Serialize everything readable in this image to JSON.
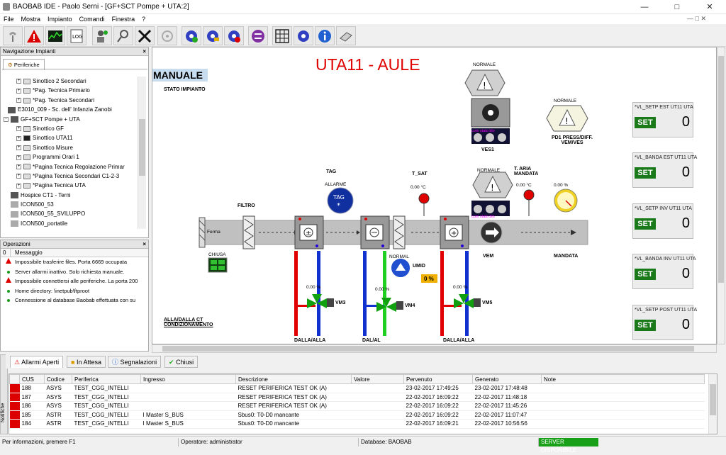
{
  "window": {
    "title": "BAOBAB IDE - Paolo Serni - [GF+SCT Pompe + UTA:2]"
  },
  "menu": [
    "File",
    "Mostra",
    "Impianto",
    "Comandi",
    "Finestra",
    "?"
  ],
  "nav": {
    "title": "Navigazione Impianti",
    "tab": "Periferiche",
    "items": [
      "Sinottico 2 Secondari",
      "*Pag. Tecnica Primario",
      "*Pag. Tecnica Secondari",
      "E3010_009 - Sc. dell' Infanzia Zanobi",
      "GF+SCT Pompe + UTA",
      "Sinottico GF",
      "Sinottico UTA11",
      "Sinottico Misure",
      "Programmi Orari 1",
      "*Pagina Tecnica Regolazione Primar",
      "*Pagina Tecnica Secondari C1-2-3",
      "*Pagina Tecnica UTA",
      "Hospice CT1 - Terni",
      "ICON500_53",
      "ICON500_55_SVILUPPO",
      "ICON500_portatile"
    ]
  },
  "ops": {
    "title": "Operazioni",
    "col_num": "0",
    "col_msg": "Messaggio",
    "rows": [
      {
        "type": "err",
        "text": "Impossibile trasferire files. Porta 6669 occupata"
      },
      {
        "type": "ok",
        "text": "Server allarmi inattivo. Solo richiesta manuale."
      },
      {
        "type": "err",
        "text": "Impossibile connettersi alle periferiche. La porta 200"
      },
      {
        "type": "ok",
        "text": "Home directory: \\inetpub\\ftproot"
      },
      {
        "type": "ok",
        "text": "Connessione al database Baobab effettuata con su"
      }
    ]
  },
  "synoptic": {
    "title": "UTA11 - AULE",
    "mode": "MANUALE",
    "stato": "STATO IMPIANTO",
    "filtro": "FILTRO",
    "ferma": "Ferma",
    "chiusa": "CHIUSA",
    "tag": "TAG",
    "allarme": "ALLARME",
    "tsat": "T_SAT",
    "tsat_val": "0.00 °C",
    "taria": "T. ARIA MANDATA",
    "taria_val": "0.00 °C",
    "press_val": "0.00 %",
    "umid": "UMID",
    "umid_normal": "NORMAL",
    "umid_val": "0 %",
    "ves_normale": "NORMALE",
    "ves": "VES1",
    "pd1_normale": "NORMALE",
    "pd1": "PD1 PRESS/DIFF. VEM/VES",
    "vem_normale": "NORMALE",
    "vem": "VEM",
    "mandata": "MANDATA",
    "com_stato": "com  stato  blo",
    "vm3": "VM3",
    "vm3_val": "0.00 %",
    "vm4": "VM4",
    "vm4_val": "0.00 %",
    "vm5": "VM5",
    "vm5_val": "0.00 %",
    "dalla1": "DALLA/ALLA",
    "dalla2": "DAL/AL",
    "dalla3": "DALLA/ALLA",
    "ct": "ALLA/DALLA CT CONDIZIONAMENTO"
  },
  "setpoints": [
    {
      "label": "*VL_SETP EST UT11 UTA",
      "btn": "SET",
      "value": "0"
    },
    {
      "label": "*VL_BANDA EST UT11 UTA",
      "btn": "SET",
      "value": "0"
    },
    {
      "label": "*VL_SETP INV UT11 UTA",
      "btn": "SET",
      "value": "0"
    },
    {
      "label": "*VL_BANDA INV UT11 UTA",
      "btn": "SET",
      "value": "0"
    },
    {
      "label": "*VL_SETP POST UT11 UTA",
      "btn": "SET",
      "value": "0"
    }
  ],
  "bottom_tabs": [
    "Allarmi Aperti",
    "In Attesa",
    "Segnalazioni",
    "Chiusi"
  ],
  "notifiche": "Notifiche",
  "alarms": {
    "columns": [
      "CUS",
      "Codice",
      "Periferica",
      "Ingresso",
      "Descrizione",
      "Valore",
      "Pervenuto",
      "Generato",
      "Note"
    ],
    "rows": [
      [
        "188",
        "ASYS",
        "TEST_CGG_INTELLI",
        "",
        "RESET PERIFERICA TEST OK (A)",
        "",
        "23-02-2017 17:49:25",
        "23-02-2017 17:48:48",
        ""
      ],
      [
        "187",
        "ASYS",
        "TEST_CGG_INTELLI",
        "",
        "RESET PERIFERICA TEST OK (A)",
        "",
        "22-02-2017 16:09:22",
        "22-02-2017 11:48:18",
        ""
      ],
      [
        "186",
        "ASYS",
        "TEST_CGG_INTELLI",
        "",
        "RESET PERIFERICA TEST OK (A)",
        "",
        "22-02-2017 16:09:22",
        "22-02-2017 11:45:26",
        ""
      ],
      [
        "185",
        "ASTR",
        "TEST_CGG_INTELLI",
        "I Master S_BUS",
        "Sbus0: T0-D0 mancante",
        "",
        "22-02-2017 16:09:22",
        "22-02-2017 11:07:47",
        ""
      ],
      [
        "184",
        "ASTR",
        "TEST_CGG_INTELLI",
        "I Master S_BUS",
        "Sbus0: T0-D0 mancante",
        "",
        "22-02-2017 16:09:21",
        "22-02-2017 10:56:56",
        ""
      ]
    ]
  },
  "status": {
    "info": "Per informazioni, premere F1",
    "operator": "Operatore: administrator",
    "db": "Database: BAOBAB",
    "server": "SERVER DISPONIBILE"
  },
  "colors": {
    "red_pipe": "#e00000",
    "blue_pipe": "#1030d0",
    "green_pipe": "#20d020",
    "set_green": "#1a7a1a",
    "server_green": "#18a018"
  }
}
